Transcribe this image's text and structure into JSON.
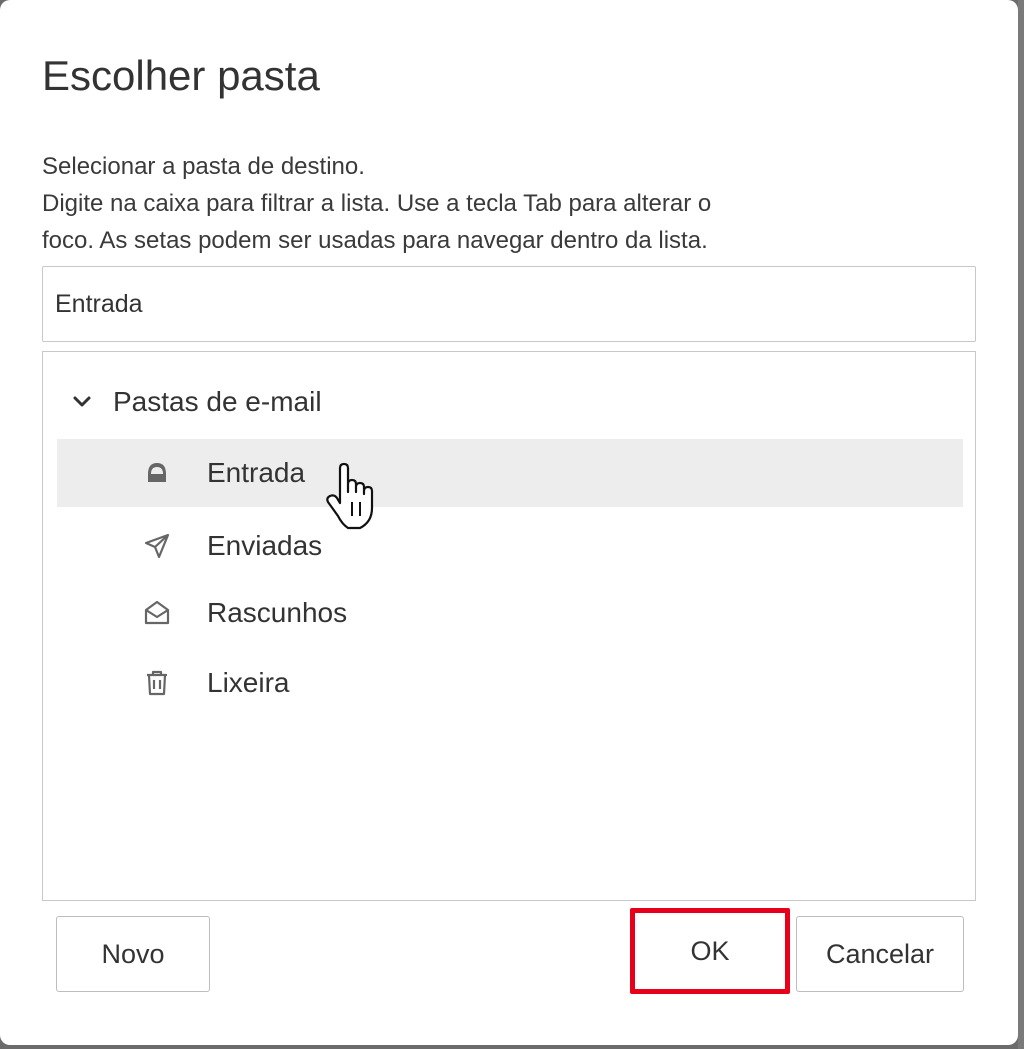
{
  "dialog": {
    "title": "Escolher pasta",
    "description_line1": "Selecionar a pasta de destino.",
    "description_line2": "Digite na caixa para filtrar a lista. Use a tecla Tab para alterar o",
    "description_line3": "foco. As setas podem ser usadas para navegar dentro da lista."
  },
  "filter": {
    "value": "Entrada"
  },
  "tree": {
    "group_label": "Pastas de e-mail",
    "group_expanded": true,
    "items": [
      {
        "label": "Entrada",
        "icon": "inbox-icon",
        "selected": true
      },
      {
        "label": "Enviadas",
        "icon": "send-icon",
        "selected": false
      },
      {
        "label": "Rascunhos",
        "icon": "drafts-icon",
        "selected": false
      },
      {
        "label": "Lixeira",
        "icon": "trash-icon",
        "selected": false
      }
    ]
  },
  "buttons": {
    "new_label": "Novo",
    "ok_label": "OK",
    "cancel_label": "Cancelar"
  },
  "colors": {
    "highlight_border": "#e8001b",
    "selected_row": "#ededed",
    "text": "#333333"
  }
}
